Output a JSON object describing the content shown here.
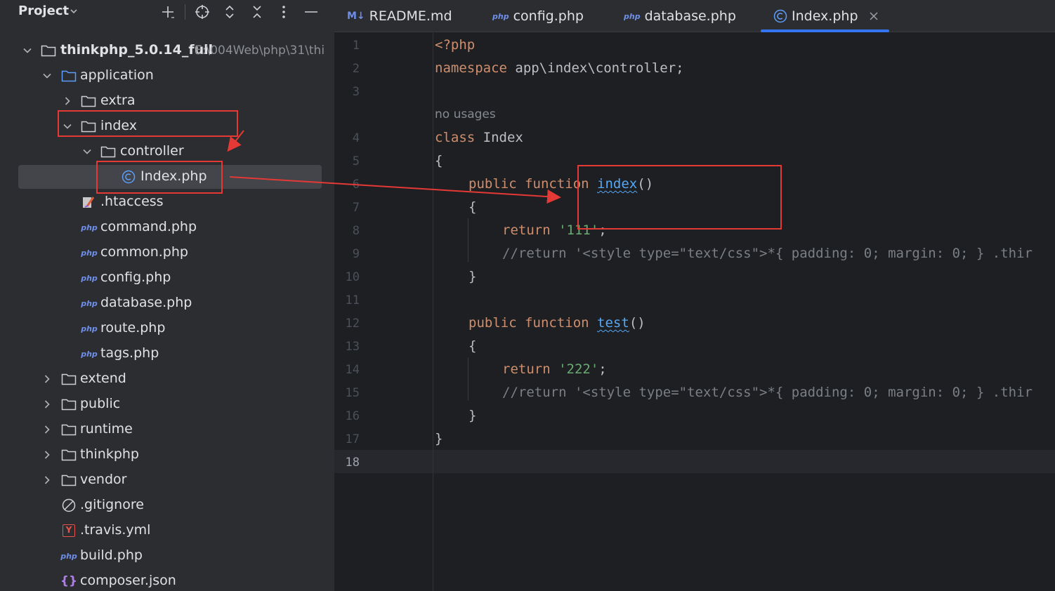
{
  "project_panel": {
    "title": "Project",
    "header_icons": [
      "plus-icon",
      "crosshair-icon",
      "expand-icon",
      "collapse-icon",
      "more-icon",
      "minimize-icon"
    ]
  },
  "tree": {
    "root": {
      "label": "thinkphp_5.0.14_full",
      "path": "E:\\004Web\\php\\31\\thi"
    },
    "application": "application",
    "extra": "extra",
    "index": "index",
    "controller": "controller",
    "index_php": "Index.php",
    "htaccess": ".htaccess",
    "command_php": "command.php",
    "common_php": "common.php",
    "config_php": "config.php",
    "database_php": "database.php",
    "route_php": "route.php",
    "tags_php": "tags.php",
    "extend": "extend",
    "public": "public",
    "runtime": "runtime",
    "thinkphp": "thinkphp",
    "vendor": "vendor",
    "gitignore": ".gitignore",
    "travis": ".travis.yml",
    "build_php": "build.php",
    "composer_json": "composer.json",
    "php_badge": "php",
    "json_badge": "{}",
    "yml_badge": "Y"
  },
  "tabs": [
    {
      "label": "README.md",
      "icon": "M↓"
    },
    {
      "label": "config.php",
      "icon": "php"
    },
    {
      "label": "database.php",
      "icon": "php"
    },
    {
      "label": "Index.php",
      "icon": "class-icon",
      "active": true
    }
  ],
  "editor": {
    "line_numbers": [
      "1",
      "2",
      "3",
      "4",
      "5",
      "6",
      "7",
      "8",
      "9",
      "10",
      "11",
      "12",
      "13",
      "14",
      "15",
      "16",
      "17",
      "18"
    ],
    "current_line": "18",
    "usage_hint": "no usages",
    "code": {
      "l1": "<?php",
      "l2_kw": "namespace",
      "l2_rest": " app\\index\\controller;",
      "l4_kw": "class",
      "l4_rest": " Index",
      "l5": "{",
      "l6_kw": "public function",
      "l6_fn": "index",
      "l6_rest": "()",
      "l7": "{",
      "l8_kw": "return",
      "l8_str": "'111'",
      "l8_end": ";",
      "l9": "//return '<style type=\"text/css\">*{ padding: 0; margin: 0; } .thir",
      "l10": "}",
      "l12_kw": "public function",
      "l12_fn": "test",
      "l12_rest": "()",
      "l13": "{",
      "l14_kw": "return",
      "l14_str": "'222'",
      "l14_end": ";",
      "l15": "//return '<style type=\"text/css\">*{ padding: 0; margin: 0; } .thir",
      "l16": "}",
      "l17": "}"
    }
  },
  "colors": {
    "panel_bg": "#2b2d30",
    "editor_bg": "#1e1f22",
    "keyword": "#cf8e6d",
    "string": "#6aab73",
    "function": "#56a8f5",
    "comment": "#7a7e85",
    "annotation": "#e53935",
    "tab_accent": "#3574f0"
  }
}
